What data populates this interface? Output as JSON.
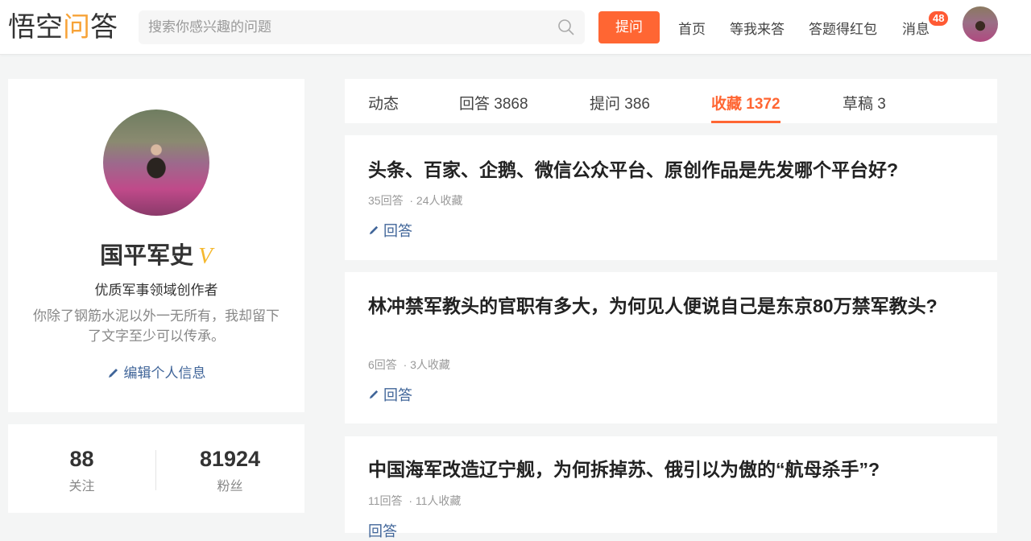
{
  "header": {
    "logo": "悟空问答",
    "search_placeholder": "搜索你感兴趣的问题",
    "ask_label": "提问",
    "nav": [
      "首页",
      "等我来答",
      "答题得红包",
      "消息"
    ],
    "message_badge": "48"
  },
  "profile": {
    "name": "国平军史",
    "verified": "V",
    "title": "优质军事领域创作者",
    "bio": "你除了钢筋水泥以外一无所有，我却留下了文字至少可以传承。",
    "edit_label": "编辑个人信息"
  },
  "stats": [
    {
      "value": "88",
      "label": "关注"
    },
    {
      "value": "81924",
      "label": "粉丝"
    }
  ],
  "tabs": [
    {
      "label": "动态"
    },
    {
      "label": "回答 3868"
    },
    {
      "label": "提问 386"
    },
    {
      "label": "收藏 1372"
    },
    {
      "label": "草稿 3"
    }
  ],
  "questions": [
    {
      "title": "头条、百家、企鹅、微信公众平台、原创作品是先发哪个平台好?",
      "answers": "35回答",
      "favorites": "24人收藏",
      "answer_label": "回答"
    },
    {
      "title": "林冲禁军教头的官职有多大，为何见人便说自己是东京80万禁军教头?",
      "answers": "6回答",
      "favorites": "3人收藏",
      "answer_label": "回答"
    },
    {
      "title": "中国海军改造辽宁舰，为何拆掉苏、俄引以为傲的“航母杀手”?",
      "answers": "11回答",
      "favorites": "11人收藏",
      "answer_label": "回答"
    }
  ],
  "colors": {
    "accent": "#ff6633",
    "link": "#406599",
    "verified": "#f5b82e"
  }
}
